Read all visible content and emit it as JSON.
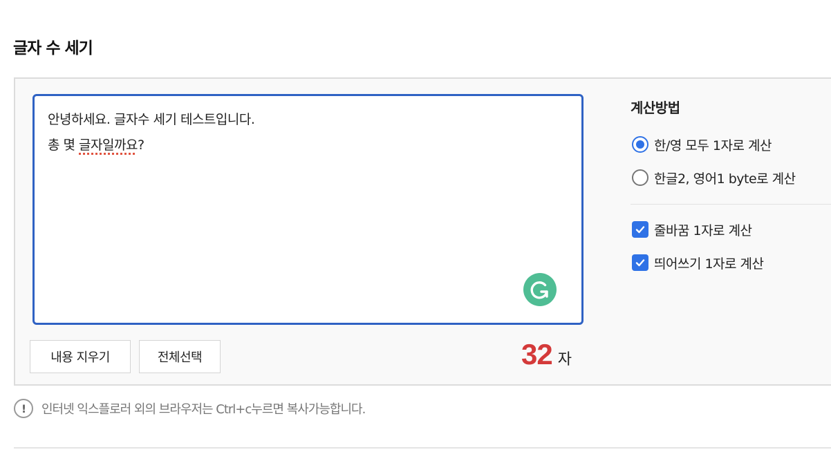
{
  "page": {
    "title": "글자 수 세기"
  },
  "editor": {
    "text_line1": "안녕하세요. 글자수 세기 테스트입니다.",
    "text_line2_a": "총 몇 ",
    "text_line2_b": "글자일까요",
    "text_line2_c": "?",
    "accent_color": "#2f62c4"
  },
  "buttons": {
    "clear_label": "내용 지우기",
    "select_all_label": "전체선택"
  },
  "count": {
    "value": "32",
    "unit": "자",
    "color": "#d43a3a"
  },
  "options": {
    "title": "계산방법",
    "radio_1": "한/영 모두 1자로 계산",
    "radio_2": "한글2, 영어1 byte로 계산",
    "selected_radio": 1,
    "check_1": "줄바꿈 1자로 계산",
    "check_2": "띄어쓰기 1자로 계산",
    "check_1_checked": true,
    "check_2_checked": true
  },
  "notice": {
    "icon": "exclamation-icon",
    "text": "인터넷 익스플로러 외의 브라우저는 Ctrl+c누르면 복사가능합니다."
  }
}
